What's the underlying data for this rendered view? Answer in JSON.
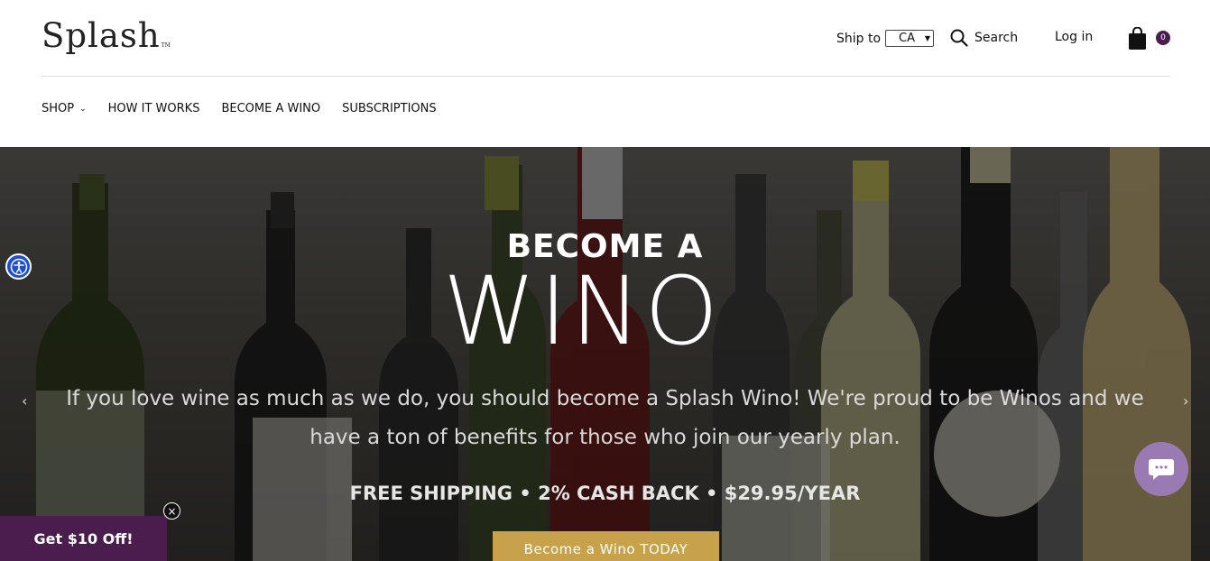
{
  "brand": {
    "logo_text": "Splash",
    "tm": "TM"
  },
  "header": {
    "ship_to_label": "Ship to",
    "ship_to_value": "CA",
    "search_label": "Search",
    "login_label": "Log in",
    "cart_count": "0"
  },
  "nav": {
    "items": [
      {
        "label": "SHOP"
      },
      {
        "label": "HOW IT WORKS"
      },
      {
        "label": "BECOME A WINO"
      },
      {
        "label": "SUBSCRIPTIONS"
      }
    ]
  },
  "hero": {
    "title_small": "BECOME A",
    "title_big": "WINO",
    "description": "If you love wine as much as we do, you should become a Splash Wino! We're proud to be Winos and we have a ton of benefits for those who join our yearly plan.",
    "benefits": "FREE SHIPPING • 2% CASH BACK • $29.95/YEAR",
    "cta_label": "Become a Wino TODAY"
  },
  "promo": {
    "label": "Get $10 Off!"
  },
  "colors": {
    "brand_purple": "#4a1d4e",
    "wino_purple": "#6b2a7d",
    "cta_gold": "#c8a24a",
    "chat_bubble": "#9a7ab2",
    "a11y_blue": "#1a4ed8"
  }
}
